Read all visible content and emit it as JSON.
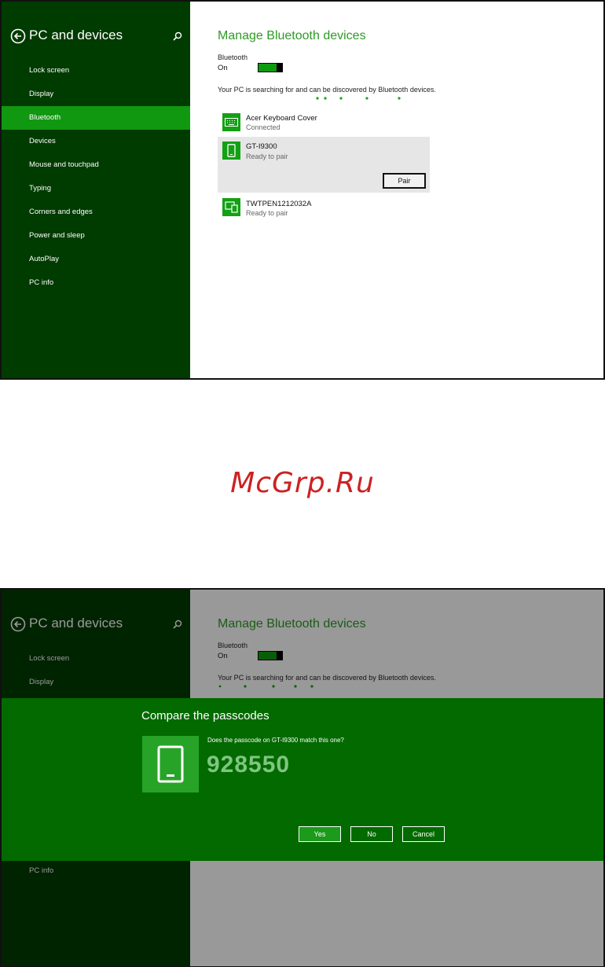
{
  "screen1": {
    "sidebar": {
      "title": "PC and devices",
      "items": [
        {
          "label": "Lock screen"
        },
        {
          "label": "Display"
        },
        {
          "label": "Bluetooth"
        },
        {
          "label": "Devices"
        },
        {
          "label": "Mouse and touchpad"
        },
        {
          "label": "Typing"
        },
        {
          "label": "Corners and edges"
        },
        {
          "label": "Power and sleep"
        },
        {
          "label": "AutoPlay"
        },
        {
          "label": "PC info"
        }
      ],
      "selected_item": "Bluetooth"
    },
    "main": {
      "title": "Manage Bluetooth devices",
      "bluetooth_label": "Bluetooth",
      "bluetooth_state": "On",
      "search_message": "Your PC is searching for and can be discovered by Bluetooth devices.",
      "devices": [
        {
          "name": "Acer Keyboard Cover",
          "status": "Connected",
          "icon": "keyboard-icon"
        },
        {
          "name": "GT-I9300",
          "status": "Ready to pair",
          "icon": "phone-icon",
          "action": "Pair"
        },
        {
          "name": "TWTPEN1212032A",
          "status": "Ready to pair",
          "icon": "computer-icon"
        }
      ]
    }
  },
  "watermark": "McGrp.Ru",
  "screen2": {
    "sidebar": {
      "title": "PC and devices",
      "items": [
        {
          "label": "Lock screen"
        },
        {
          "label": "Display"
        },
        {
          "label": "PC info"
        }
      ]
    },
    "main": {
      "title": "Manage Bluetooth devices",
      "bluetooth_label": "Bluetooth",
      "bluetooth_state": "On",
      "search_message": "Your PC is searching for and can be discovered by Bluetooth devices."
    },
    "dialog": {
      "title": "Compare the passcodes",
      "question": "Does the passcode on GT-I9300 match this one?",
      "passcode": "928550",
      "buttons": {
        "yes": "Yes",
        "no": "No",
        "cancel": "Cancel"
      }
    }
  },
  "colors": {
    "sidebar_bg": "#003b00",
    "sidebar_selected": "#119811",
    "accent_green": "#2e9a25",
    "dialog_bg": "#036a00"
  }
}
